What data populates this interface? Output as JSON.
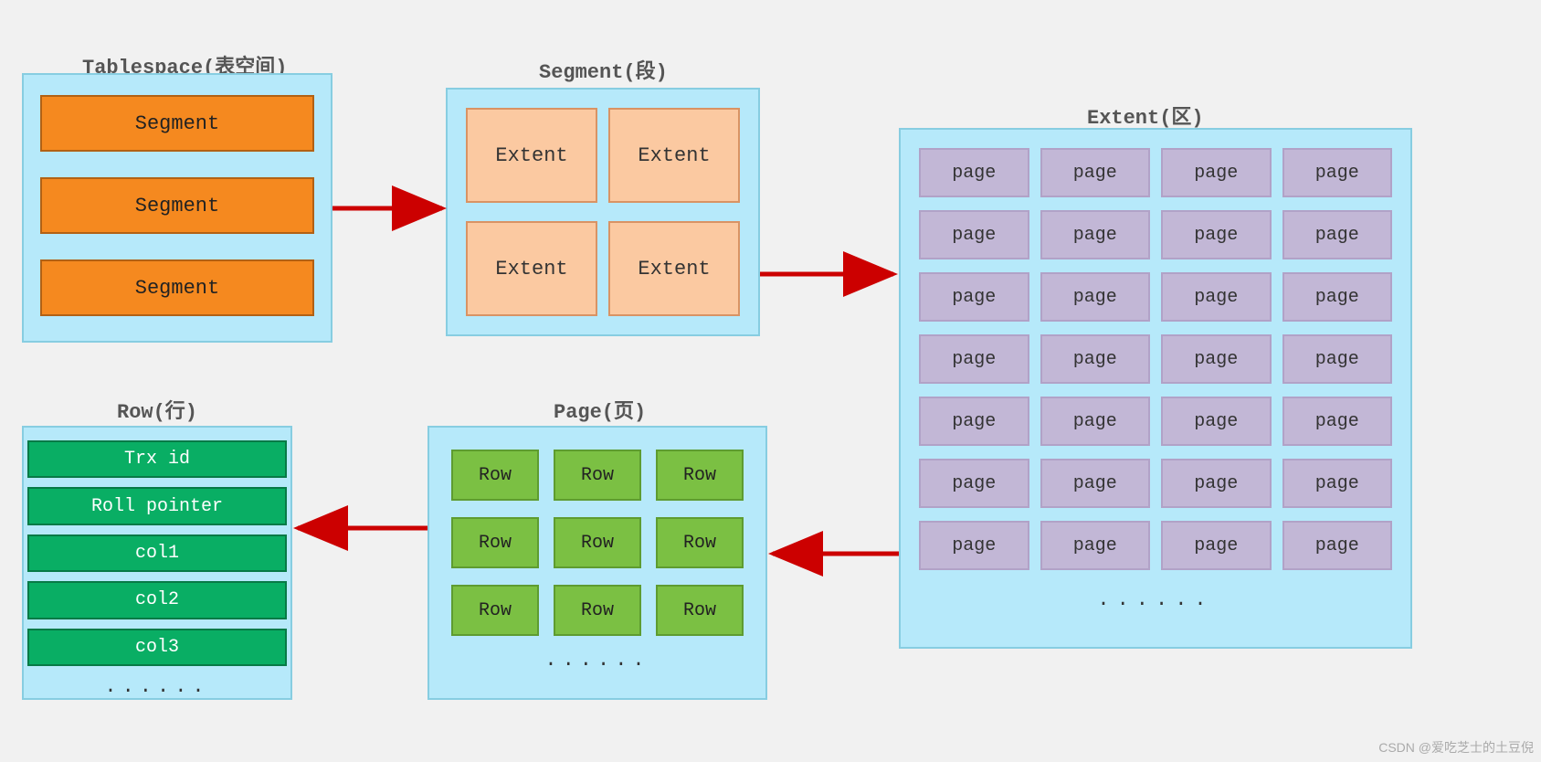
{
  "tablespace": {
    "title": "Tablespace(表空间)",
    "items": [
      "Segment",
      "Segment",
      "Segment"
    ]
  },
  "segment": {
    "title": "Segment(段)",
    "items": [
      "Extent",
      "Extent",
      "Extent",
      "Extent"
    ]
  },
  "extent": {
    "title": "Extent(区)",
    "page_label": "page",
    "rows": 7,
    "cols": 4,
    "ellipsis": "......"
  },
  "page": {
    "title": "Page(页)",
    "row_label": "Row",
    "rows": 3,
    "cols": 3,
    "ellipsis": "......"
  },
  "row": {
    "title": "Row(行)",
    "items": [
      "Trx id",
      "Roll pointer",
      "col1",
      "col2",
      "col3"
    ],
    "ellipsis": "......"
  },
  "watermark": "CSDN @爱吃芝士的土豆倪"
}
